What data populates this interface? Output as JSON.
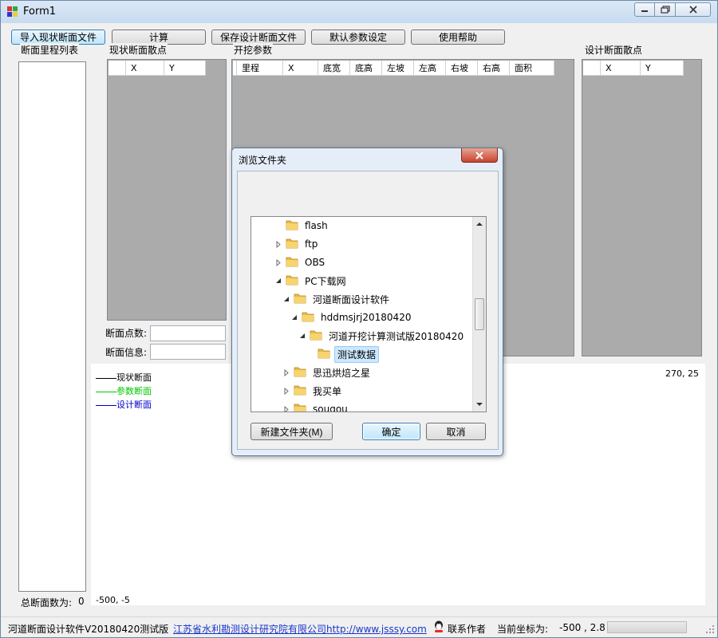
{
  "window": {
    "title": "Form1"
  },
  "toolbar": {
    "import_label": "导入现状断面文件",
    "calc_label": "计算",
    "save_label": "保存设计断面文件",
    "default_label": "默认参数设定",
    "help_label": "使用帮助"
  },
  "groups": {
    "section_list": "断面里程列表",
    "current_points": "现状断面散点",
    "excavation_params": "开挖参数",
    "design_points": "设计断面散点"
  },
  "current_grid": {
    "columns": [
      "X",
      "Y"
    ]
  },
  "params_grid": {
    "columns": [
      "里程",
      "X",
      "底宽",
      "底高",
      "左坡",
      "左高",
      "右坡",
      "右高",
      "面积"
    ]
  },
  "design_grid": {
    "columns": [
      "X",
      "Y"
    ]
  },
  "fields": {
    "point_count_label": "断面点数:",
    "section_info_label": "断面信息:"
  },
  "section_total": {
    "label": "总断面数为:",
    "value": "0"
  },
  "legend": [
    {
      "label": "现状断面",
      "color": "#000000"
    },
    {
      "label": "参数断面",
      "color": "#00c800"
    },
    {
      "label": "设计断面",
      "color": "#0000c8"
    }
  ],
  "plot": {
    "top_right_coord": "270, 25",
    "bottom_left_coord": "-500, -5"
  },
  "status": {
    "app_version": "河道断面设计软件V20180420测试版",
    "org_link": "江苏省水利勘测设计研究院有限公司http://www.jsssy.com",
    "contact_label": "联系作者",
    "coords_label": "当前坐标为:",
    "coords_value": "-500 , 2.8"
  },
  "dialog": {
    "title": "浏览文件夹",
    "new_folder_label": "新建文件夹(M)",
    "ok_label": "确定",
    "cancel_label": "取消",
    "tree": [
      {
        "label": "flash",
        "level": 0,
        "expander": "none",
        "selected": false
      },
      {
        "label": "ftp",
        "level": 0,
        "expander": "collapsed",
        "selected": false
      },
      {
        "label": "OBS",
        "level": 0,
        "expander": "collapsed",
        "selected": false
      },
      {
        "label": "PC下载网",
        "level": 0,
        "expander": "expanded",
        "selected": false
      },
      {
        "label": "河道断面设计软件",
        "level": 1,
        "expander": "expanded",
        "selected": false
      },
      {
        "label": "hddmsjrj20180420",
        "level": 2,
        "expander": "expanded",
        "selected": false
      },
      {
        "label": "河道开挖计算测试版20180420",
        "level": 3,
        "expander": "expanded",
        "selected": false
      },
      {
        "label": "测试数据",
        "level": 4,
        "expander": "none",
        "selected": true
      },
      {
        "label": "思迅烘焙之星",
        "level": 1,
        "expander": "collapsed",
        "selected": false
      },
      {
        "label": "我买单",
        "level": 1,
        "expander": "collapsed",
        "selected": false
      },
      {
        "label": "sougou",
        "level": 1,
        "expander": "collapsed",
        "selected": false
      }
    ]
  },
  "colors": {
    "grid_bg": "#ababab",
    "link": "#1a36c9",
    "title_bar": "#c7dbef"
  }
}
